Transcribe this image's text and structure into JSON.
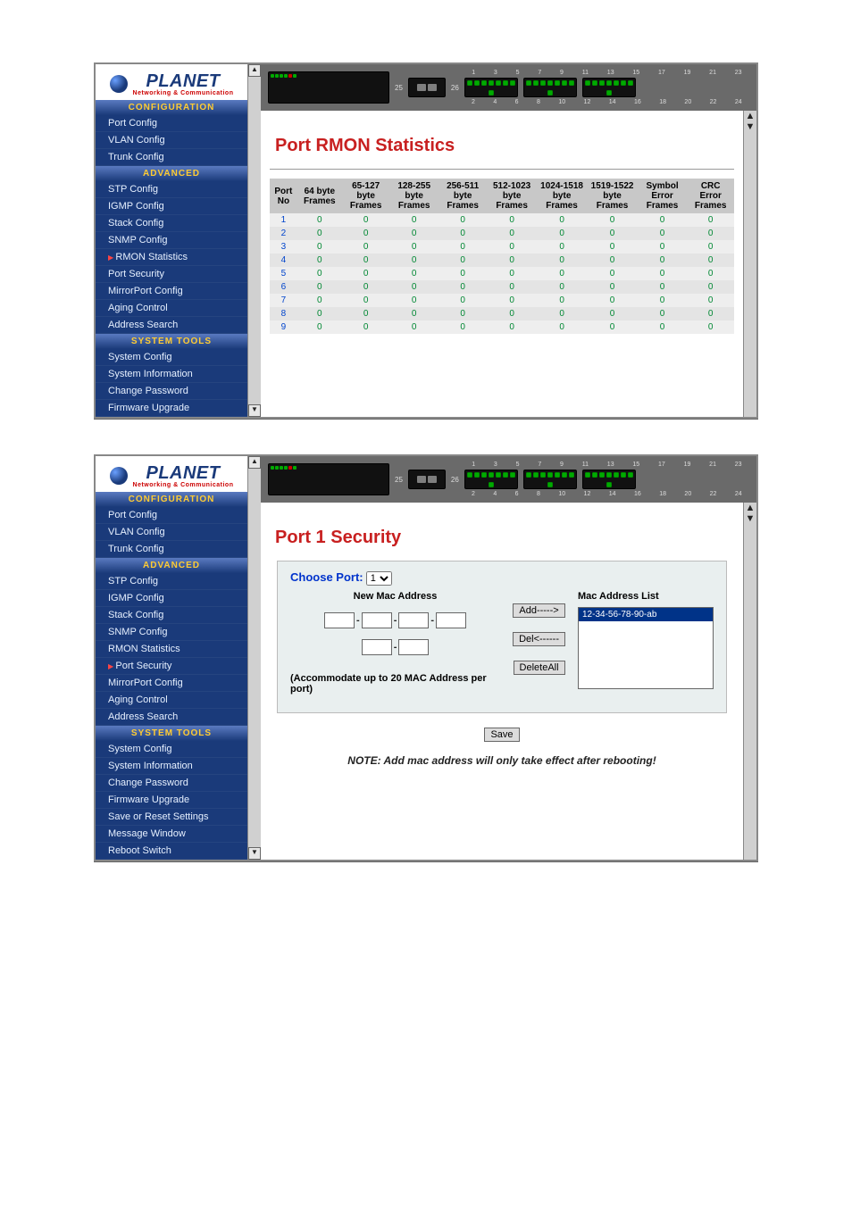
{
  "brand": {
    "name": "PLANET",
    "tagline": "Networking & Communication"
  },
  "nav": {
    "sections": [
      {
        "title": "CONFIGURATION",
        "items": [
          "Port Config",
          "VLAN Config",
          "Trunk Config"
        ]
      },
      {
        "title": "ADVANCED",
        "items": [
          "STP Config",
          "IGMP Config",
          "Stack Config",
          "SNMP Config",
          "RMON Statistics",
          "Port Security",
          "MirrorPort Config",
          "Aging Control",
          "Address Search"
        ]
      },
      {
        "title": "SYSTEM TOOLS",
        "items": [
          "System Config",
          "System Information",
          "Change Password",
          "Firmware Upgrade",
          "Save or Reset Settings",
          "Message Window",
          "Reboot Switch"
        ]
      }
    ],
    "active_shot1": "RMON Statistics",
    "active_shot2": "Port Security"
  },
  "banner": {
    "uplink_labels": [
      "25",
      "26"
    ],
    "top_nums": [
      "1",
      "3",
      "5",
      "7",
      "9",
      "11",
      "13",
      "15",
      "17",
      "19",
      "21",
      "23"
    ],
    "bot_nums": [
      "2",
      "4",
      "6",
      "8",
      "10",
      "12",
      "14",
      "16",
      "18",
      "20",
      "22",
      "24"
    ]
  },
  "rmon": {
    "title": "Port RMON Statistics",
    "headers": [
      "Port No",
      "64 byte Frames",
      "65-127 byte Frames",
      "128-255 byte Frames",
      "256-511 byte Frames",
      "512-1023 byte Frames",
      "1024-1518 byte Frames",
      "1519-1522 byte Frames",
      "Symbol Error Frames",
      "CRC Error Frames"
    ],
    "rows": [
      [
        "1",
        "0",
        "0",
        "0",
        "0",
        "0",
        "0",
        "0",
        "0",
        "0"
      ],
      [
        "2",
        "0",
        "0",
        "0",
        "0",
        "0",
        "0",
        "0",
        "0",
        "0"
      ],
      [
        "3",
        "0",
        "0",
        "0",
        "0",
        "0",
        "0",
        "0",
        "0",
        "0"
      ],
      [
        "4",
        "0",
        "0",
        "0",
        "0",
        "0",
        "0",
        "0",
        "0",
        "0"
      ],
      [
        "5",
        "0",
        "0",
        "0",
        "0",
        "0",
        "0",
        "0",
        "0",
        "0"
      ],
      [
        "6",
        "0",
        "0",
        "0",
        "0",
        "0",
        "0",
        "0",
        "0",
        "0"
      ],
      [
        "7",
        "0",
        "0",
        "0",
        "0",
        "0",
        "0",
        "0",
        "0",
        "0"
      ],
      [
        "8",
        "0",
        "0",
        "0",
        "0",
        "0",
        "0",
        "0",
        "0",
        "0"
      ],
      [
        "9",
        "0",
        "0",
        "0",
        "0",
        "0",
        "0",
        "0",
        "0",
        "0"
      ]
    ]
  },
  "security": {
    "title": "Port 1 Security",
    "choose_label": "Choose Port:",
    "port_selected": "1",
    "new_mac_label": "New Mac Address",
    "list_label": "Mac Address List",
    "mac_dash": "-",
    "accom": "(Accommodate up to 20 MAC Address per port)",
    "btn_add": "Add----->",
    "btn_del": "Del<------",
    "btn_delall": "DeleteAll",
    "btn_save": "Save",
    "sample_mac": "12-34-56-78-90-ab",
    "note": "NOTE: Add mac address will only take effect after rebooting!"
  },
  "scroll": {
    "up": "▲",
    "down": "▼"
  }
}
